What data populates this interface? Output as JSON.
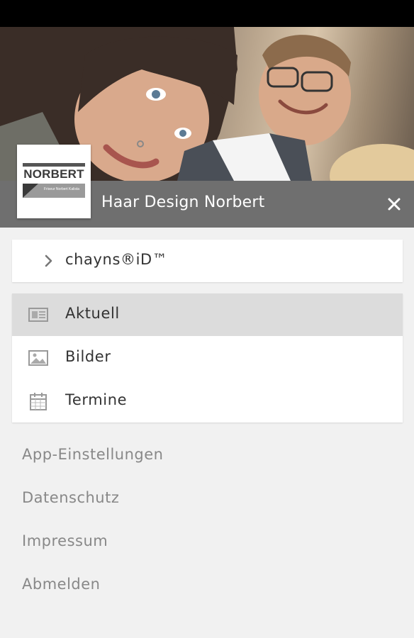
{
  "header": {
    "title": "Haar Design Norbert",
    "close_icon": "close-icon"
  },
  "logo": {
    "wordmark": "NORBERT",
    "tagline": "Friseur Norbert Kalista"
  },
  "chayns_id": {
    "label": "chayns®iD™",
    "icon": "chevron-right-icon"
  },
  "nav": {
    "items": [
      {
        "label": "Aktuell",
        "icon": "newspaper-icon",
        "active": true
      },
      {
        "label": "Bilder",
        "icon": "image-icon",
        "active": false
      },
      {
        "label": "Termine",
        "icon": "calendar-icon",
        "active": false
      }
    ]
  },
  "links": [
    {
      "label": "App-Einstellungen"
    },
    {
      "label": "Datenschutz"
    },
    {
      "label": "Impressum"
    },
    {
      "label": "Abmelden"
    }
  ],
  "colors": {
    "header_bar": "#6f6f6f",
    "background": "#f1f1f1",
    "active_item": "#dcdcdc",
    "status_bar": "#000000"
  }
}
